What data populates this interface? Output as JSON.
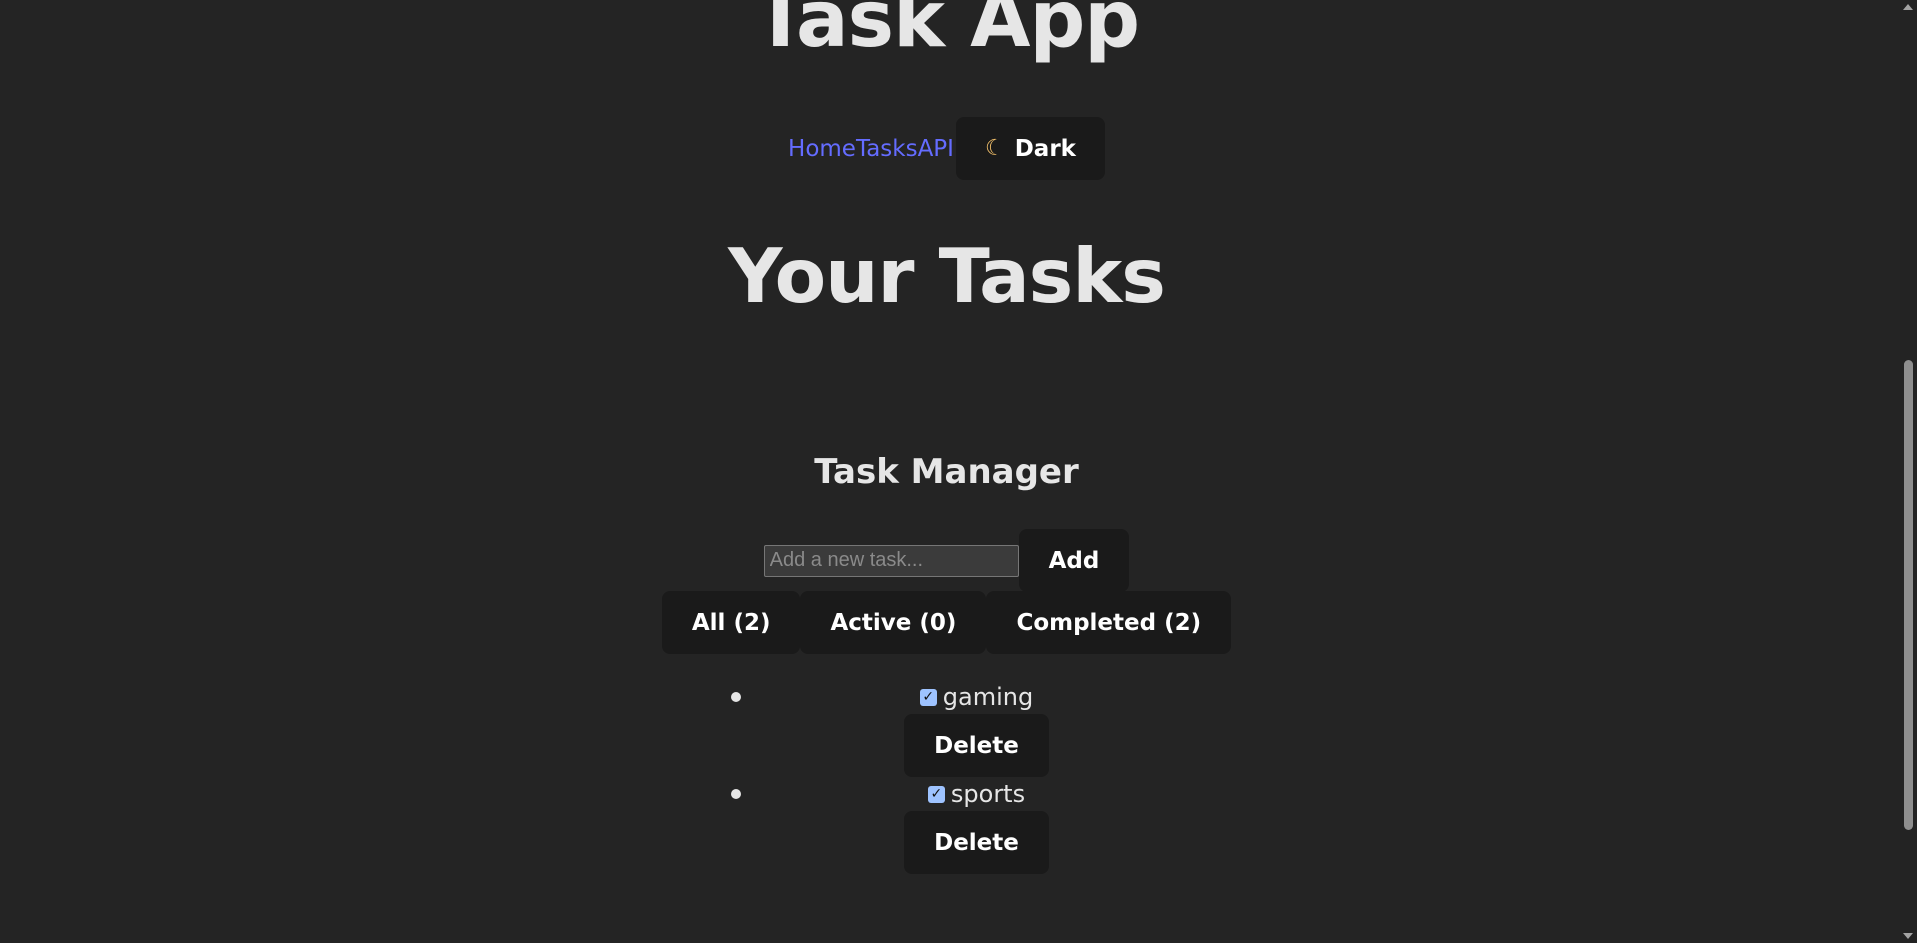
{
  "app": {
    "title": "Task App"
  },
  "nav": {
    "links": [
      "Home",
      "Tasks",
      "API"
    ],
    "theme_button": {
      "icon": "moon-icon",
      "label": "Dark"
    },
    "link_color": "#646cff"
  },
  "page": {
    "title": "Your Tasks"
  },
  "manager": {
    "title": "Task Manager",
    "input": {
      "placeholder": "Add a new task...",
      "value": ""
    },
    "add_label": "Add",
    "filters": [
      "All (2)",
      "Active (0)",
      "Completed (2)"
    ],
    "tasks": [
      {
        "text": "gaming",
        "done": true,
        "delete_label": "Delete"
      },
      {
        "text": "sports",
        "done": true,
        "delete_label": "Delete"
      }
    ]
  },
  "colors": {
    "background": "#242424",
    "button": "#1a1a1a",
    "checkbox": "#9ec3ff"
  }
}
